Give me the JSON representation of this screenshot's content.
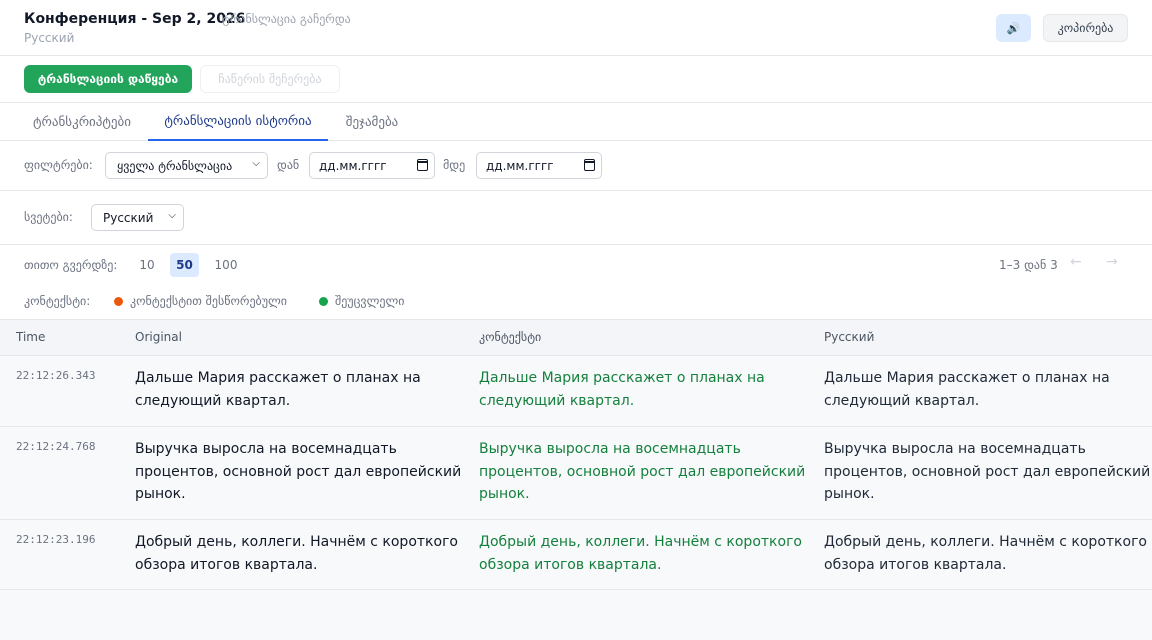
{
  "header": {
    "title": "Конференция - Sep 2, 2026",
    "status": "ტრანსლაცია გაჩერდა",
    "language": "Русский",
    "speaker_icon": "🔊",
    "copy_label": "კოპირება"
  },
  "actions": {
    "start_label": "ტრანსლაციის დაწყება",
    "stop_label": "ჩაწერის შეჩერება"
  },
  "tabs": [
    {
      "label": "ტრანსკრიპტები",
      "active": false
    },
    {
      "label": "ტრანსლაციის ისტორია",
      "active": true
    },
    {
      "label": "შეჯამება",
      "active": false
    }
  ],
  "filters": {
    "label": "ფილტრები:",
    "type_value": "ყველა ტრანსლაცია",
    "from_label": "დან",
    "from_value": "дд.мм.гггг",
    "to_label": "მდე",
    "to_value": "дд.мм.гггг"
  },
  "columns_filter": {
    "label": "სვეტები:",
    "value": "Русский"
  },
  "pagination": {
    "per_page_label": "თითო გვერდზე:",
    "options": [
      "10",
      "50",
      "100"
    ],
    "selected": "50",
    "range": "1–3 დან 3",
    "prev": "←",
    "next": "→"
  },
  "legend": {
    "label": "კონტექსტი:",
    "items": [
      {
        "label": "კონტექსტით შესწორებული",
        "color": "#ea580c"
      },
      {
        "label": "შეუცვლელი",
        "color": "#16a34a"
      }
    ]
  },
  "table": {
    "headers": [
      "Time",
      "Original",
      "კონტექსტი",
      "Русский"
    ],
    "rows": [
      {
        "time": "22:12:26.343",
        "original": [
          "Дальше Мария расскажет о планах на",
          "следующий квартал."
        ],
        "context": [
          "Дальше Мария расскажет о планах на",
          "следующий квартал."
        ],
        "russian": [
          "Дальше Мария расскажет о планах на",
          "следующий квартал."
        ]
      },
      {
        "time": "22:12:24.768",
        "original": [
          "Выручка выросла на восемнадцать",
          "процентов, основной рост дал европейский",
          "рынок."
        ],
        "context": [
          "Выручка выросла на восемнадцать",
          "процентов, основной рост дал европейский",
          "рынок."
        ],
        "russian": [
          "Выручка выросла на восемнадцать",
          "процентов, основной рост дал европейский",
          "рынок."
        ]
      },
      {
        "time": "22:12:23.196",
        "original": [
          "Добрый день, коллеги. Начнём с короткого",
          "обзора итогов квартала."
        ],
        "context": [
          "Добрый день, коллеги. Начнём с короткого",
          "обзора итогов квартала."
        ],
        "russian": [
          "Добрый день, коллеги. Начнём с короткого",
          "обзора итогов квартала."
        ]
      }
    ]
  }
}
